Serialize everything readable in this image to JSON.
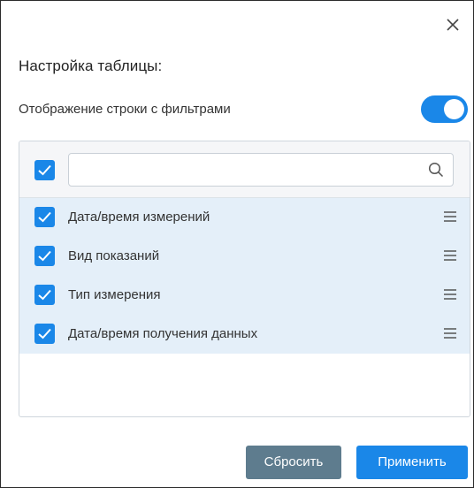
{
  "dialog": {
    "title": "Настройка таблицы:",
    "close_icon": "close-icon"
  },
  "filter_row_toggle": {
    "label": "Отображение строки с фильтрами",
    "checked": true
  },
  "panel": {
    "select_all_checked": true,
    "search": {
      "value": "",
      "placeholder": "",
      "icon": "search-icon"
    },
    "columns": [
      {
        "label": "Дата/время измерений",
        "checked": true
      },
      {
        "label": "Вид показаний",
        "checked": true
      },
      {
        "label": "Тип измерения",
        "checked": true
      },
      {
        "label": "Дата/время получения данных",
        "checked": true
      }
    ]
  },
  "buttons": {
    "reset": "Сбросить",
    "apply": "Применить"
  },
  "colors": {
    "accent": "#1a87e8",
    "secondary_button": "#5e7c8e",
    "row_highlight": "#e4eff9"
  }
}
